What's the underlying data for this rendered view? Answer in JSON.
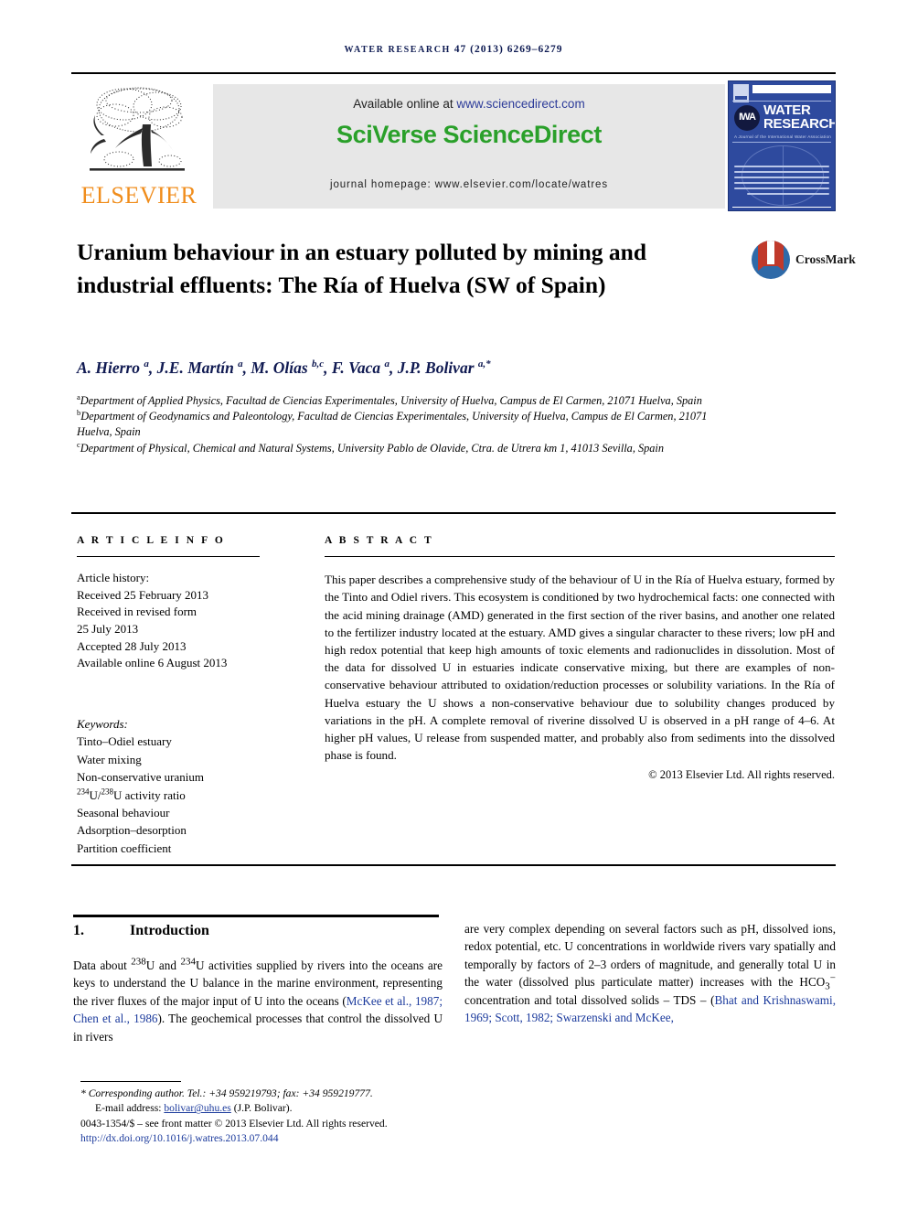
{
  "running_head": {
    "journal": "WATER RESEARCH",
    "volume_year_pages": "47 (2013) 6269–6279"
  },
  "banner": {
    "available_prefix": "Available online at ",
    "available_link": "www.sciencedirect.com",
    "brand_part1": "SciVerse",
    "brand_part2": "ScienceDirect",
    "homepage": "journal homepage: www.elsevier.com/locate/watres",
    "publisher": "ELSEVIER",
    "cover": {
      "title_line1": "WATER",
      "title_line2": "RESEARCH",
      "logo_text": "IWA",
      "subtitle": "A Journal of the International Water Association"
    }
  },
  "article": {
    "title": "Uranium behaviour in an estuary polluted by mining and industrial effluents: The Ría of Huelva (SW of Spain)",
    "crossmark_label": "CrossMark",
    "authors_html": "A. Hierro <sup>a</sup>, J.E. Martín <sup>a</sup>, M. Olías <sup>b,c</sup>, F. Vaca <sup>a</sup>, J.P. Bolivar <sup>a,*</sup>",
    "affiliations": [
      "Department of Applied Physics, Facultad de Ciencias Experimentales, University of Huelva, Campus de El Carmen, 21071 Huelva, Spain",
      "Department of Geodynamics and Paleontology, Facultad de Ciencias Experimentales, University of Huelva, Campus de El Carmen, 21071 Huelva, Spain",
      "Department of Physical, Chemical and Natural Systems, University Pablo de Olavide, Ctra. de Utrera km 1, 41013 Sevilla, Spain"
    ],
    "affiliation_marks": [
      "a",
      "b",
      "c"
    ]
  },
  "article_info": {
    "label": "A R T I C L E  I N F O",
    "history_label": "Article history:",
    "history": [
      "Received 25 February 2013",
      "Received in revised form",
      "25 July 2013",
      "Accepted 28 July 2013",
      "Available online 6 August 2013"
    ],
    "keywords_label": "Keywords:",
    "keywords": [
      "Tinto–Odiel estuary",
      "Water mixing",
      "Non-conservative uranium",
      "234U/238U activity ratio",
      "Seasonal behaviour",
      "Adsorption–desorption",
      "Partition coefficient"
    ]
  },
  "abstract": {
    "label": "A B S T R A C T",
    "text": "This paper describes a comprehensive study of the behaviour of U in the Ría of Huelva estuary, formed by the Tinto and Odiel rivers. This ecosystem is conditioned by two hydrochemical facts: one connected with the acid mining drainage (AMD) generated in the first section of the river basins, and another one related to the fertilizer industry located at the estuary. AMD gives a singular character to these rivers; low pH and high redox potential that keep high amounts of toxic elements and radionuclides in dissolution. Most of the data for dissolved U in estuaries indicate conservative mixing, but there are examples of non-conservative behaviour attributed to oxidation/reduction processes or solubility variations. In the Ría of Huelva estuary the U shows a non-conservative behaviour due to solubility changes produced by variations in the pH. A complete removal of riverine dissolved U is observed in a pH range of 4–6. At higher pH values, U release from suspended matter, and probably also from sediments into the dissolved phase is found.",
    "copyright": "© 2013 Elsevier Ltd. All rights reserved."
  },
  "introduction": {
    "number": "1.",
    "heading": "Introduction",
    "left_column_html": "Data about <sup>238</sup>U and <sup>234</sup>U activities supplied by rivers into the oceans are keys to understand the U balance in the marine environment, representing the river fluxes of the major input of U into the oceans (<span class=\"cite\">McKee et al., 1987; Chen et al., 1986</span>). The geochemical processes that control the dissolved U in rivers",
    "right_column_html": "are very complex depending on several factors such as pH, dissolved ions, redox potential, etc. U concentrations in worldwide rivers vary spatially and temporally by factors of 2–3 orders of magnitude, and generally total U in the water (dissolved plus particulate matter) increases with the HCO<sub>3</sub><sup>−</sup> concentration and total dissolved solids – TDS – (<span class=\"cite\">Bhat and Krishnaswami, 1969; Scott, 1982; Swarzenski and McKee,</span>"
  },
  "footer": {
    "corresponding": "* Corresponding author. Tel.: +34 959219793; fax: +34 959219777.",
    "email_label": "E-mail address: ",
    "email": "bolivar@uhu.es",
    "email_suffix": " (J.P. Bolivar).",
    "issn_line": "0043-1354/$ – see front matter © 2013 Elsevier Ltd. All rights reserved.",
    "doi": "http://dx.doi.org/10.1016/j.watres.2013.07.044"
  }
}
